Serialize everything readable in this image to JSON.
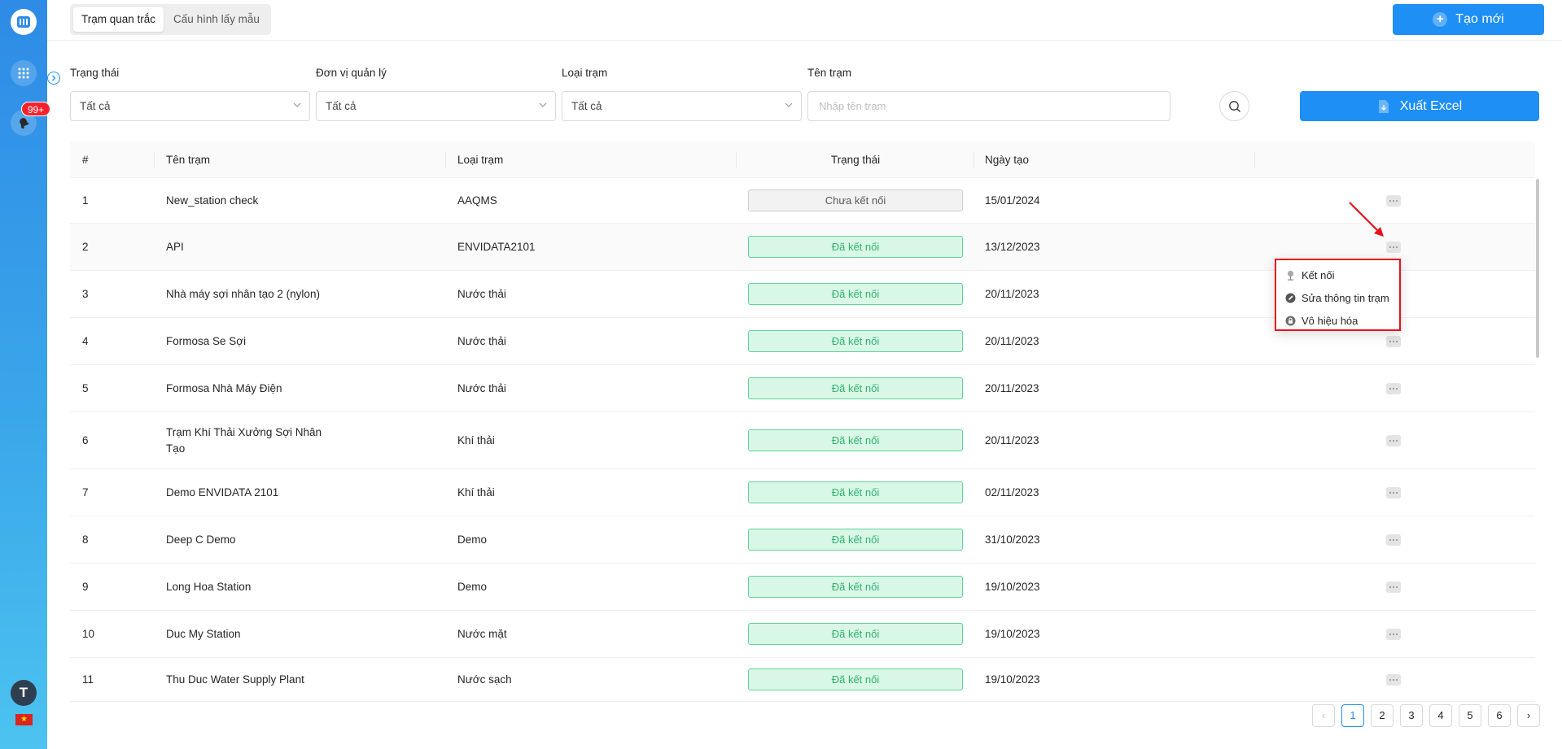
{
  "sidebar": {
    "badge_count": "99+",
    "avatar_initial": "T",
    "flag_symbol": "★"
  },
  "header": {
    "tabs": [
      {
        "label": "Trạm quan trắc",
        "active": true
      },
      {
        "label": "Cấu hình lấy mẫu",
        "active": false
      }
    ],
    "create_button": "Tạo mới"
  },
  "filters": {
    "status_label": "Trạng thái",
    "status_value": "Tất cả",
    "unit_label": "Đơn vị quản lý",
    "unit_value": "Tất cả",
    "type_label": "Loại trạm",
    "type_value": "Tất cả",
    "name_label": "Tên trạm",
    "name_placeholder": "Nhập tên trạm",
    "export_button": "Xuất Excel"
  },
  "table": {
    "columns": [
      "#",
      "Tên trạm",
      "Loại trạm",
      "Trạng thái",
      "Ngày tạo"
    ],
    "rows": [
      {
        "index": "1",
        "name": "New_station check",
        "type": "AAQMS",
        "status": "Chưa kết nối",
        "connected": false,
        "date": "15/01/2024"
      },
      {
        "index": "2",
        "name": "API",
        "type": "ENVIDATA2101",
        "status": "Đã kết nối",
        "connected": true,
        "date": "13/12/2023"
      },
      {
        "index": "3",
        "name": "Nhà máy sợi nhân tạo 2 (nylon)",
        "type": "Nước thải",
        "status": "Đã kết nối",
        "connected": true,
        "date": "20/11/2023"
      },
      {
        "index": "4",
        "name": "Formosa Se Sợi",
        "type": "Nước thải",
        "status": "Đã kết nối",
        "connected": true,
        "date": "20/11/2023"
      },
      {
        "index": "5",
        "name": "Formosa Nhà Máy Điện",
        "type": "Nước thải",
        "status": "Đã kết nối",
        "connected": true,
        "date": "20/11/2023"
      },
      {
        "index": "6",
        "name": "Trạm Khí Thải Xưởng Sợi Nhân Tạo",
        "type": "Khí thải",
        "status": "Đã kết nối",
        "connected": true,
        "date": "20/11/2023"
      },
      {
        "index": "7",
        "name": "Demo ENVIDATA 2101",
        "type": "Khí thải",
        "status": "Đã kết nối",
        "connected": true,
        "date": "02/11/2023"
      },
      {
        "index": "8",
        "name": "Deep C Demo",
        "type": "Demo",
        "status": "Đã kết nối",
        "connected": true,
        "date": "31/10/2023"
      },
      {
        "index": "9",
        "name": "Long Hoa Station",
        "type": "Demo",
        "status": "Đã kết nối",
        "connected": true,
        "date": "19/10/2023"
      },
      {
        "index": "10",
        "name": "Duc My Station",
        "type": "Nước mặt",
        "status": "Đã kết nối",
        "connected": true,
        "date": "19/10/2023"
      },
      {
        "index": "11",
        "name": "Thu Duc Water Supply Plant",
        "type": "Nước sạch",
        "status": "Đã kết nối",
        "connected": true,
        "date": "19/10/2023"
      }
    ]
  },
  "context_menu": {
    "items": [
      {
        "label": "Kết nối",
        "icon": "plug-icon"
      },
      {
        "label": "Sửa thông tin trạm",
        "icon": "edit-icon"
      },
      {
        "label": "Vô hiệu hóa",
        "icon": "lock-icon"
      }
    ]
  },
  "pagination": {
    "pages": [
      "1",
      "2",
      "3",
      "4",
      "5",
      "6"
    ],
    "current": "1",
    "prev_symbol": "‹",
    "next_symbol": "›"
  },
  "colors": {
    "primary": "#1e8ff5",
    "connected_bg": "#d9f7e6",
    "connected_text": "#2fb26e",
    "annotation_red": "#e8101a"
  }
}
